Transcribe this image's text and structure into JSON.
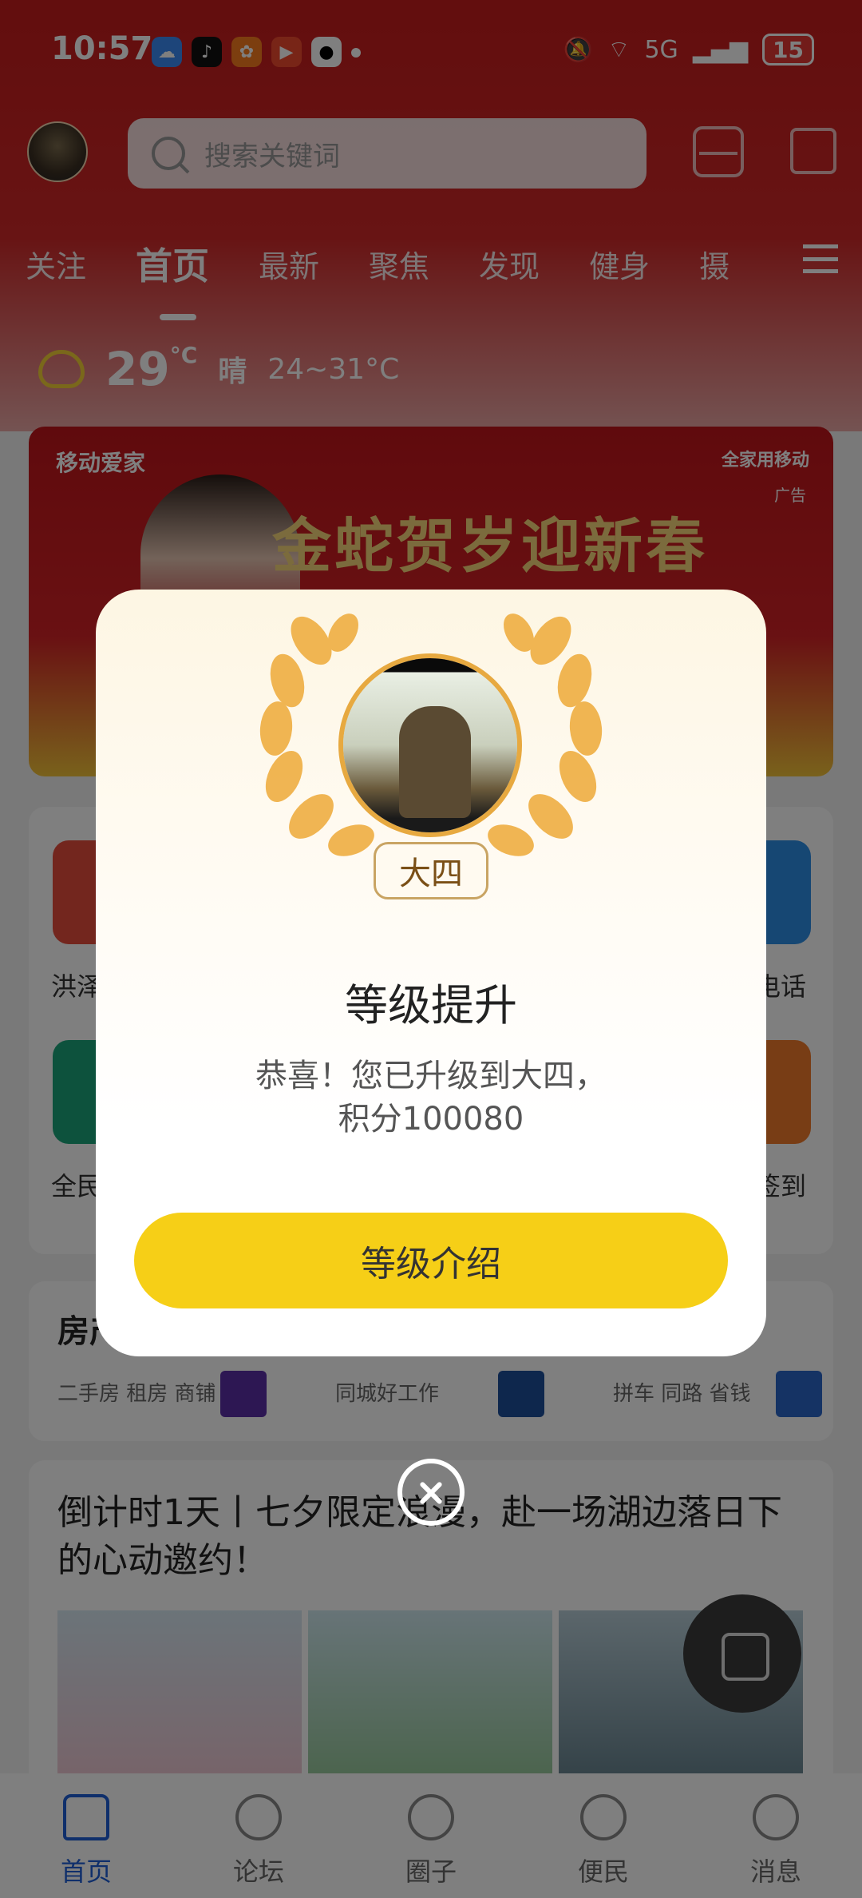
{
  "status_bar": {
    "time": "10:57",
    "network": "5G",
    "battery": "15",
    "notification_icons": [
      "weather-app-icon",
      "tiktok-icon",
      "photo-app-icon",
      "video-app-icon",
      "qq-icon"
    ],
    "status_icons": [
      "mute-bell-icon",
      "wifi-icon",
      "signal-icon"
    ]
  },
  "header": {
    "search_placeholder": "搜索关键词"
  },
  "tabs": [
    "关注",
    "首页",
    "最新",
    "聚焦",
    "发现",
    "健身",
    "摄"
  ],
  "active_tab": "首页",
  "weather": {
    "temp": "29",
    "unit": "°C",
    "condition": "晴",
    "range": "24~31°C"
  },
  "banner": {
    "brand": "移动爱家",
    "brand_right": "全家用移动",
    "ad_label": "广告",
    "headline": "金蛇贺岁迎新春"
  },
  "grid": {
    "left_label_1": "洪泽",
    "right_label_1": "电话",
    "left_label_2": "全民",
    "right_label_2": "签到"
  },
  "services": {
    "title": "房产",
    "items": [
      "二手房 租房 商铺",
      "同城好工作",
      "拼车 同路 省钱"
    ]
  },
  "news": {
    "title": "倒计时1天丨七夕限定浪漫，赴一场湖边落日下的心动邀约！"
  },
  "bottom_nav": [
    "首页",
    "论坛",
    "圈子",
    "便民",
    "消息"
  ],
  "modal": {
    "level": "大四",
    "title": "等级提升",
    "message_line1": "恭喜！您已升级到大四，",
    "message_line2": "积分100080",
    "button": "等级介绍"
  },
  "colors": {
    "header_red": "#c61c1c",
    "button_yellow": "#f6cf17",
    "wreath_gold": "#f0b24a",
    "nav_active": "#1e5fd6"
  }
}
